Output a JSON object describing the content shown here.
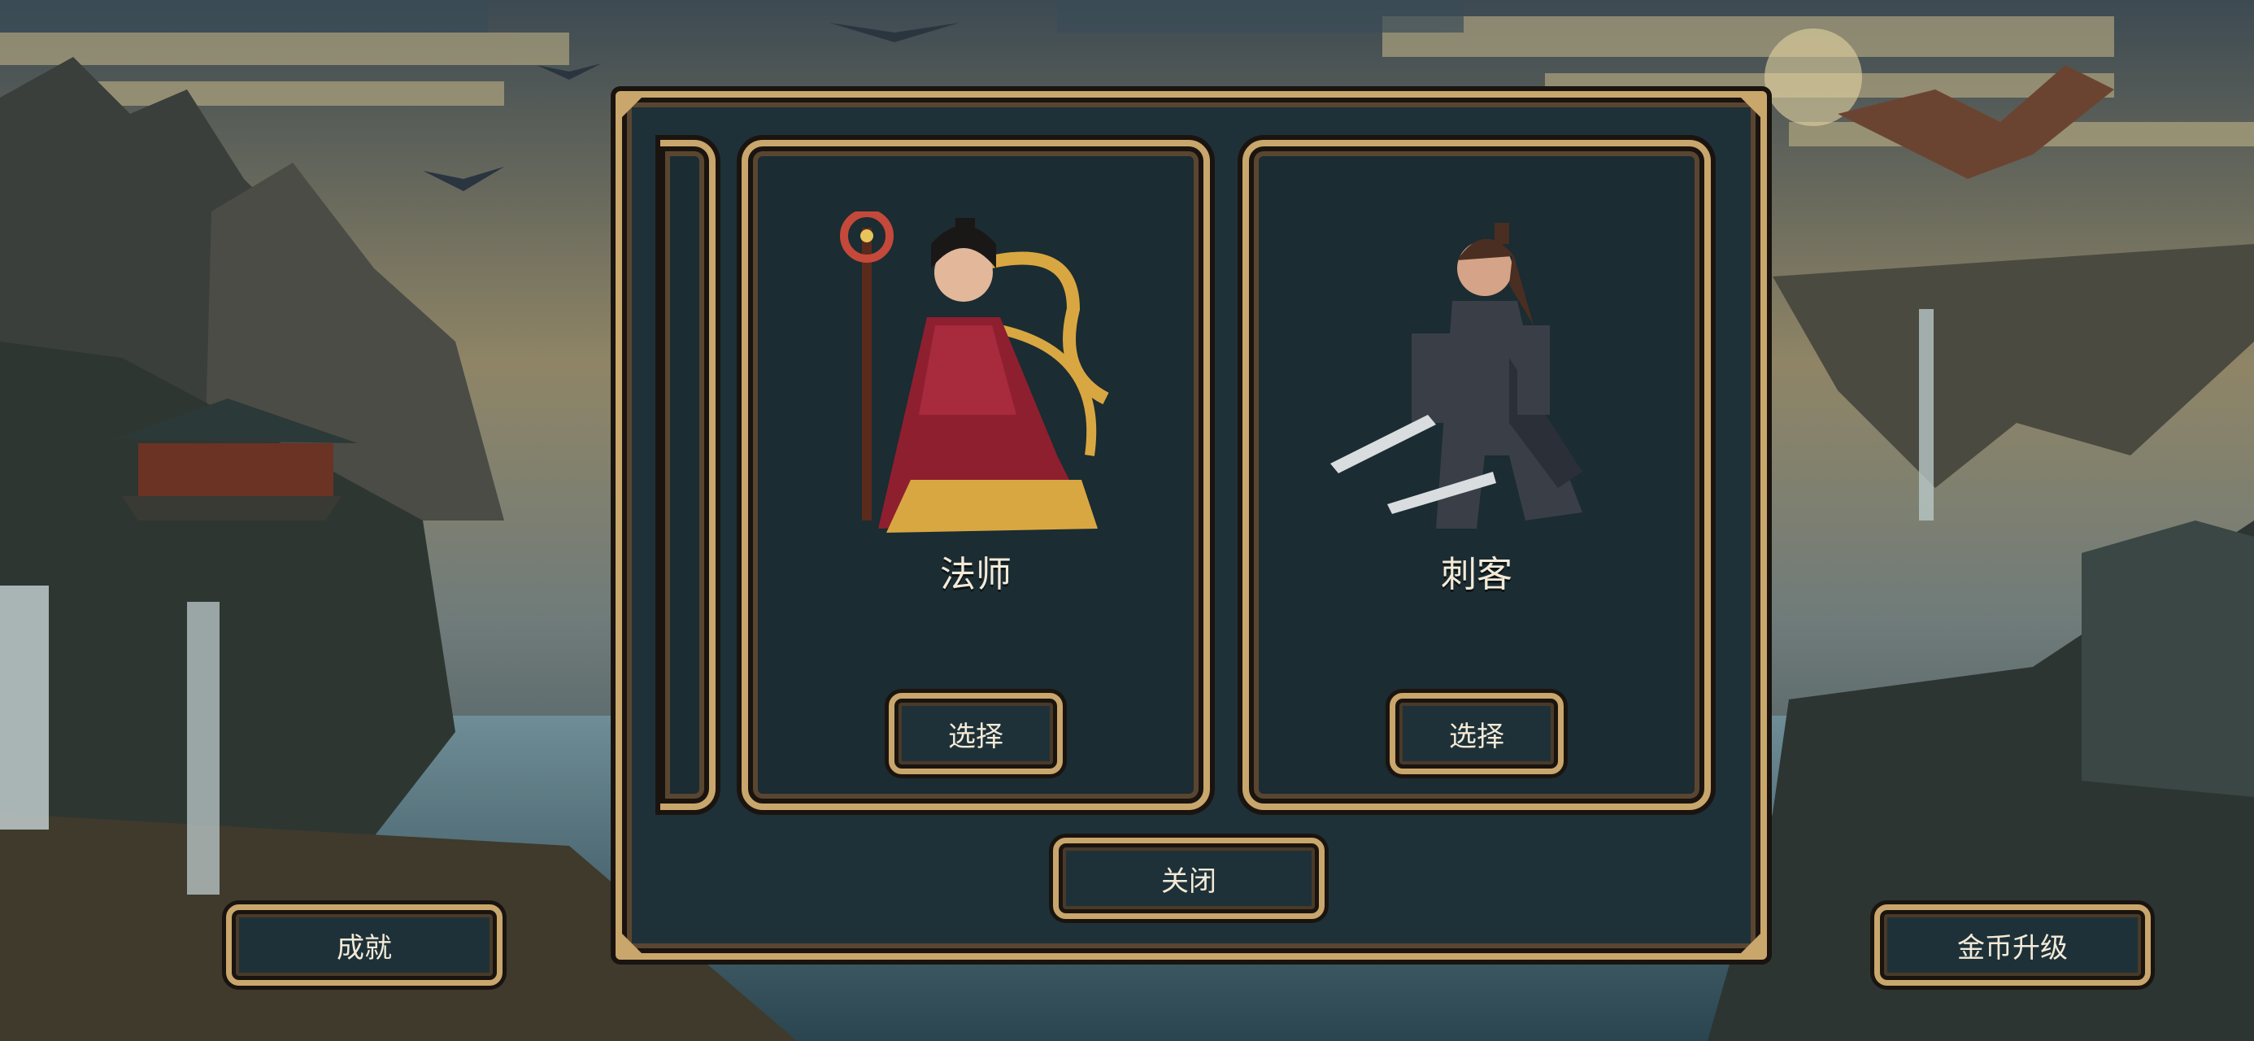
{
  "dialog": {
    "cards": [
      {
        "title": "法师",
        "button_label": "选择",
        "portrait": "mage-portrait"
      },
      {
        "title": "刺客",
        "button_label": "选择",
        "portrait": "assassin-portrait"
      }
    ],
    "close_label": "关闭"
  },
  "hud": {
    "achievements_label": "成就",
    "gold_upgrade_label": "金币升级"
  },
  "colors": {
    "frame_gold": "#c9a66b",
    "panel_dark": "#1f3138",
    "text_light": "#f3ead8"
  }
}
